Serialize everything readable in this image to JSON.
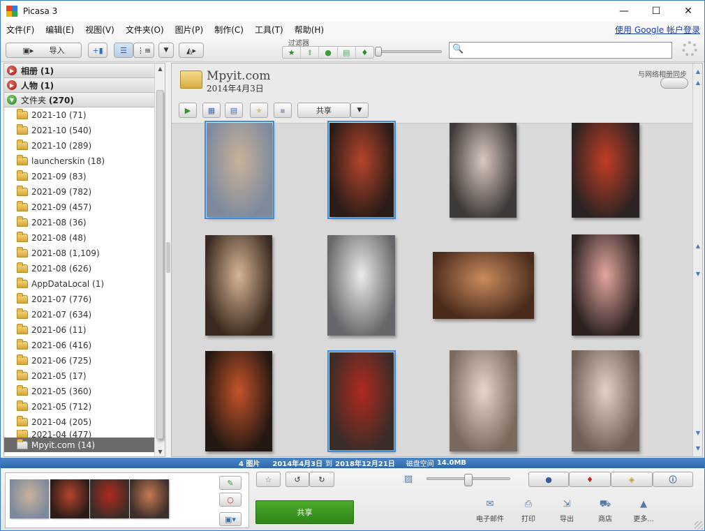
{
  "window": {
    "title": "Picasa 3",
    "min": "—",
    "max": "☐",
    "close": "✕"
  },
  "menu": {
    "items": [
      "文件(F)",
      "编辑(E)",
      "视图(V)",
      "文件夹(O)",
      "图片(P)",
      "制作(C)",
      "工具(T)",
      "帮助(H)"
    ],
    "signin": "使用 Google 帐户登录"
  },
  "toolbar": {
    "import_label": "导入",
    "filter_label": "过滤器"
  },
  "left_panel": {
    "groups": {
      "albums": {
        "name": "相册",
        "count": "(1)"
      },
      "people": {
        "name": "人物",
        "count": "(1)"
      },
      "folders": {
        "name": "文件夹",
        "count": "(270)"
      }
    },
    "folders": [
      "2021-10 (71)",
      "2021-10 (540)",
      "2021-10 (289)",
      "launcherskin (18)",
      "2021-09 (83)",
      "2021-09 (782)",
      "2021-09 (457)",
      "2021-08 (36)",
      "2021-08 (48)",
      "2021-08 (1,109)",
      "2021-08 (626)",
      "AppDataLocal (1)",
      "2021-07 (776)",
      "2021-07 (634)",
      "2021-06 (11)",
      "2021-06 (416)",
      "2021-06 (725)",
      "2021-05 (17)",
      "2021-05 (360)",
      "2021-05 (712)",
      "2021-04 (205)",
      "2021-04 (477)"
    ],
    "selected_folder": "Mpyit.com (14)"
  },
  "album": {
    "title": "Mpyit.com",
    "date": "2014年4月3日",
    "sync_label": "与网络相册同步",
    "share_label": "共享"
  },
  "photos": [
    {
      "selected": true,
      "c1": "#7d8a9c",
      "c2": "#c9b29a"
    },
    {
      "selected": true,
      "c1": "#2b1c17",
      "c2": "#b5452d"
    },
    {
      "selected": false,
      "c1": "#3e3a38",
      "c2": "#d9c8bf"
    },
    {
      "selected": false,
      "c1": "#2c2422",
      "c2": "#c23d26"
    },
    {
      "selected": false,
      "c1": "#3a2a1f",
      "c2": "#d7b596"
    },
    {
      "selected": false,
      "c1": "#67666a",
      "c2": "#ecebe8"
    },
    {
      "selected": false,
      "c1": "#4a2b1c",
      "c2": "#c98b5e"
    },
    {
      "selected": false,
      "c1": "#2c2220",
      "c2": "#e3a6a0"
    },
    {
      "selected": false,
      "c1": "#241812",
      "c2": "#c4542a"
    },
    {
      "selected": true,
      "c1": "#3a2c27",
      "c2": "#b02a1f"
    },
    {
      "selected": false,
      "c1": "#7a6a5e",
      "c2": "#e6d6cb"
    },
    {
      "selected": false,
      "c1": "#6f5f55",
      "c2": "#e2d2c6"
    }
  ],
  "status": {
    "count": "4 图片",
    "range_start": "2014年4月3日",
    "range_to": "到",
    "range_end": "2018年12月21日",
    "disk_label": "磁盘空间",
    "disk_value": "14.0MB"
  },
  "bottom": {
    "tray_thumbs": [
      {
        "c1": "#7d8a9c",
        "c2": "#c9b29a"
      },
      {
        "c1": "#2b1c17",
        "c2": "#b5452d"
      },
      {
        "c1": "#3a2c27",
        "c2": "#b02a1f"
      },
      {
        "c1": "#3a2f2a",
        "c2": "#c77a52"
      }
    ],
    "share_button": "共享",
    "actions": {
      "email": "电子邮件",
      "print": "打印",
      "export": "导出",
      "shop": "商店",
      "more": "更多..."
    }
  },
  "colors": {
    "accent": "#3b8fe0",
    "status_bar": "#2e69ad",
    "share_green": "#3a9a22"
  },
  "icons": {
    "search": "search-icon",
    "spinner": "loading-spinner-icon",
    "folder": "folder-icon",
    "star": "star-icon",
    "rotate_left": "rotate-left-icon",
    "rotate_right": "rotate-right-icon",
    "person": "person-icon",
    "geotag": "map-pin-icon",
    "tag": "tag-icon",
    "info": "info-icon"
  }
}
